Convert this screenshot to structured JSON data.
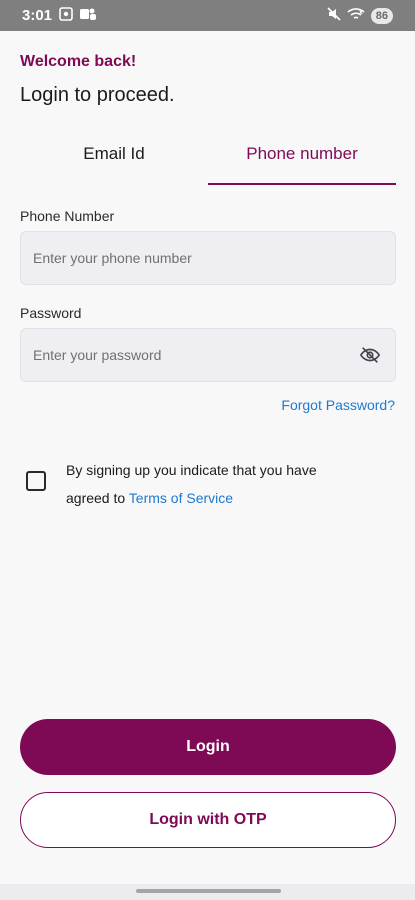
{
  "status_bar": {
    "time": "3:01",
    "battery": "86",
    "icons": [
      "screenshot-icon",
      "teams-icon",
      "mute-icon",
      "wifi-icon",
      "battery-icon"
    ]
  },
  "header": {
    "welcome": "Welcome back!",
    "subtitle": "Login to proceed."
  },
  "tabs": [
    {
      "label": "Email Id",
      "active": false
    },
    {
      "label": "Phone number",
      "active": true
    }
  ],
  "form": {
    "phone": {
      "label": "Phone Number",
      "placeholder": "Enter your phone number",
      "value": ""
    },
    "password": {
      "label": "Password",
      "placeholder": "Enter your password",
      "value": "",
      "toggle_icon": "eye-off-icon"
    },
    "forgot": "Forgot Password?"
  },
  "terms": {
    "checked": false,
    "text_line1": "By signing up you indicate that you have",
    "text_prefix": "agreed to ",
    "link": "Terms of Service"
  },
  "actions": {
    "login": "Login",
    "login_otp": "Login with OTP"
  },
  "colors": {
    "brand": "#7e0a56",
    "link": "#1e7ad0",
    "background": "#f8f8f9",
    "input_bg": "#efeff3"
  }
}
